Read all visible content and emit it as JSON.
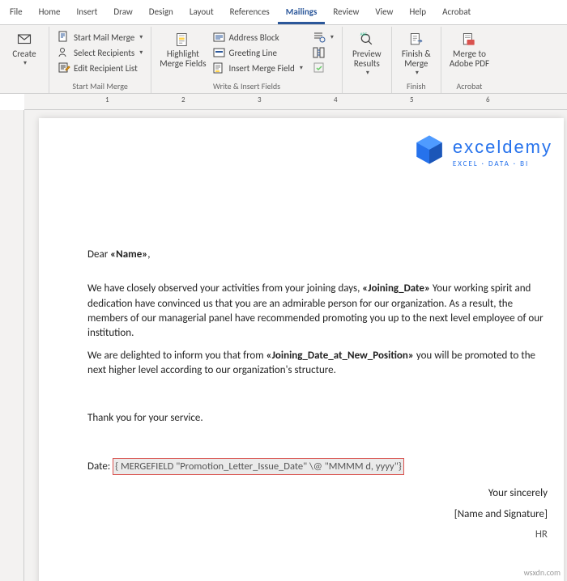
{
  "tabs": {
    "file": "File",
    "home": "Home",
    "insert": "Insert",
    "draw": "Draw",
    "design": "Design",
    "layout": "Layout",
    "references": "References",
    "mailings": "Mailings",
    "review": "Review",
    "view": "View",
    "help": "Help",
    "acrobat": "Acrobat"
  },
  "ribbon": {
    "create": "Create",
    "start_mm": "Start Mail Merge",
    "select_rcp": "Select Recipients",
    "edit_rcp": "Edit Recipient List",
    "grp_start": "Start Mail Merge",
    "highlight": "Highlight\nMerge Fields",
    "address": "Address Block",
    "greeting": "Greeting Line",
    "insert_mf": "Insert Merge Field",
    "grp_write": "Write & Insert Fields",
    "preview": "Preview\nResults",
    "finish": "Finish &\nMerge",
    "grp_finish": "Finish",
    "adobe": "Merge to\nAdobe PDF",
    "grp_adobe": "Acrobat"
  },
  "ruler": [
    "1",
    "2",
    "3",
    "4",
    "5",
    "6"
  ],
  "logo": {
    "text": "exceldemy",
    "sub": "EXCEL · DATA · BI"
  },
  "doc": {
    "dear": "Dear ",
    "name": "«Name»",
    "comma": ",",
    "p1a": "We have closely observed your activities from your joining days, ",
    "joining": "«Joining_Date»",
    "p1b": " Your working spirit and dedication have convinced us that you are an admirable person for our organization. As a result, the members of our managerial panel have recommended promoting you up to the next level employee of our institution.",
    "p2a": "We are delighted to inform you that from ",
    "newpos": "«Joining_Date_at_New_Position»",
    "p2b": " you will be promoted to the next higher level according to our organization's structure.",
    "thanks": "Thank you for your service.",
    "date_label": "Date: ",
    "field_code": "{ MERGEFIELD \"Promotion_Letter_Issue_Date\" \\@ \"MMMM d, yyyy\"}",
    "sign1": "Your sincerely",
    "sign2": "[Name and Signature]",
    "hr": "HR"
  },
  "wm": "wsxdn.com"
}
